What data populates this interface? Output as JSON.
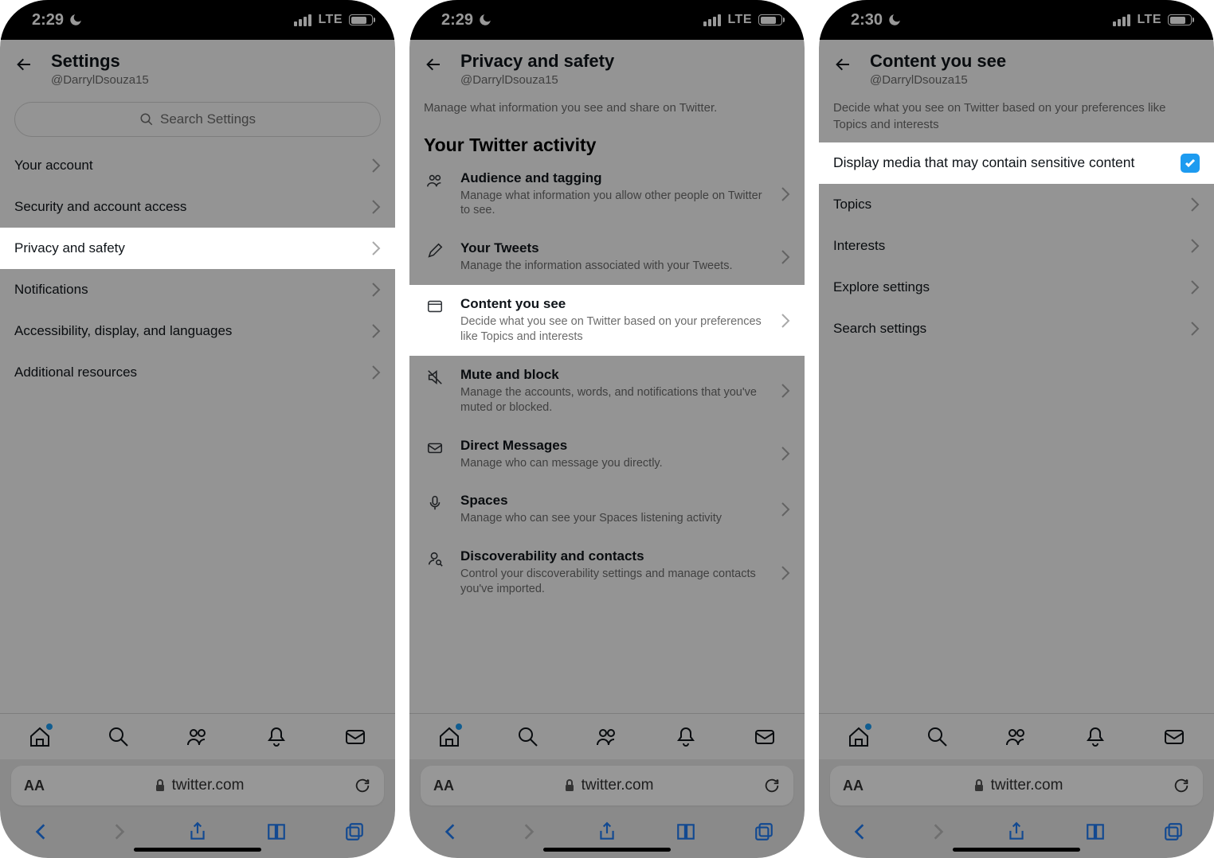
{
  "status": {
    "time_a": "2:29",
    "time_c": "2:30",
    "network": "LTE"
  },
  "user": {
    "handle": "@DarrylDsouza15"
  },
  "safari": {
    "url": "twitter.com"
  },
  "phone1": {
    "header": "Settings",
    "search_placeholder": "Search Settings",
    "items": [
      {
        "label": "Your account"
      },
      {
        "label": "Security and account access"
      },
      {
        "label": "Privacy and safety",
        "highlight": true
      },
      {
        "label": "Notifications"
      },
      {
        "label": "Accessibility, display, and languages"
      },
      {
        "label": "Additional resources"
      }
    ]
  },
  "phone2": {
    "header": "Privacy and safety",
    "desc": "Manage what information you see and share on Twitter.",
    "section": "Your Twitter activity",
    "items": [
      {
        "title": "Audience and tagging",
        "desc": "Manage what information you allow other people on Twitter to see."
      },
      {
        "title": "Your Tweets",
        "desc": "Manage the information associated with your Tweets."
      },
      {
        "title": "Content you see",
        "desc": "Decide what you see on Twitter based on your preferences like Topics and interests",
        "highlight": true
      },
      {
        "title": "Mute and block",
        "desc": "Manage the accounts, words, and notifications that you've muted or blocked."
      },
      {
        "title": "Direct Messages",
        "desc": "Manage who can message you directly."
      },
      {
        "title": "Spaces",
        "desc": "Manage who can see your Spaces listening activity"
      },
      {
        "title": "Discoverability and contacts",
        "desc": "Control your discoverability settings and manage contacts you've imported."
      }
    ]
  },
  "phone3": {
    "header": "Content you see",
    "desc": "Decide what you see on Twitter based on your preferences like Topics and interests",
    "toggle_label": "Display media that may contain sensitive content",
    "items": [
      {
        "label": "Topics"
      },
      {
        "label": "Interests"
      },
      {
        "label": "Explore settings"
      },
      {
        "label": "Search settings"
      }
    ]
  }
}
